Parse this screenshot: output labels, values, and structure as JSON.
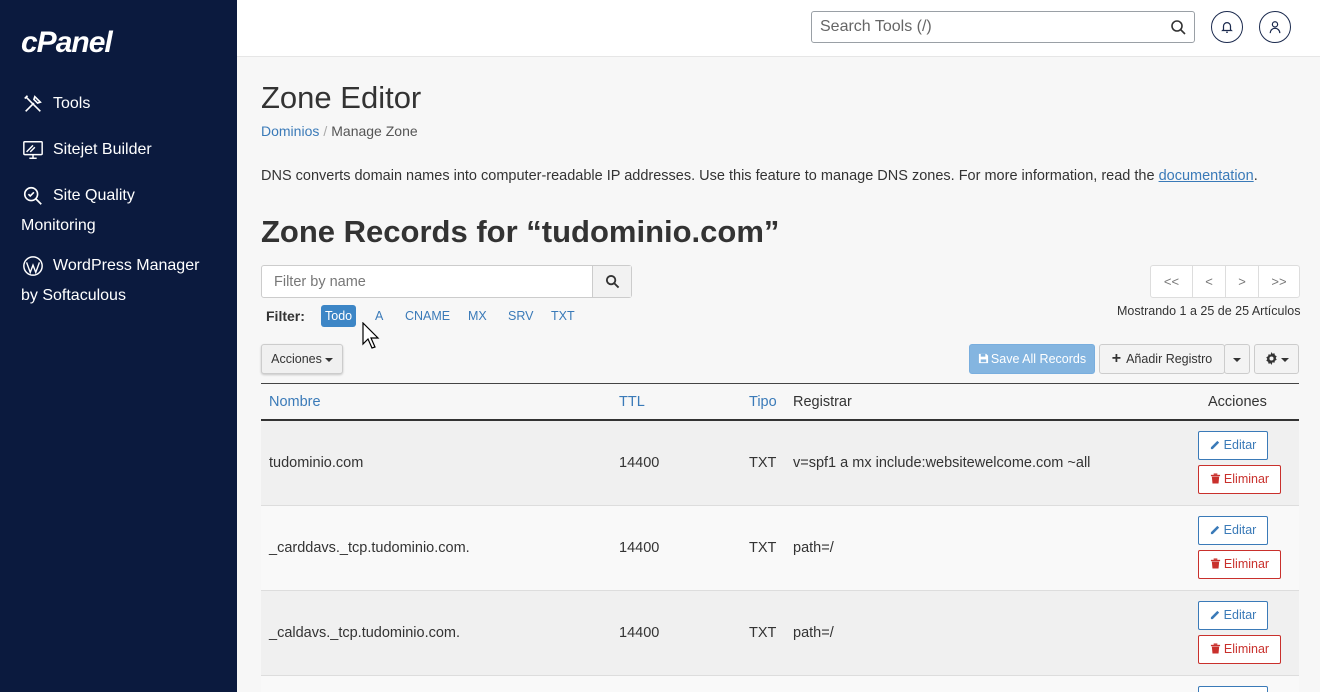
{
  "sidebar": {
    "logo": "cPanel",
    "items": [
      {
        "label": "Tools",
        "icon": "tools-icon"
      },
      {
        "label": "Sitejet Builder",
        "icon": "sitejet-icon"
      },
      {
        "label": "Site Quality",
        "label2": "Monitoring",
        "icon": "site-quality-icon"
      },
      {
        "label": "WordPress Manager",
        "label2": "by Softaculous",
        "icon": "wordpress-icon"
      }
    ]
  },
  "topbar": {
    "search_placeholder": "Search Tools (/)"
  },
  "page": {
    "title": "Zone Editor",
    "breadcrumb": {
      "link": "Dominios",
      "separator": "/",
      "current": "Manage Zone"
    },
    "description": "DNS converts domain names into computer-readable IP addresses. Use this feature to manage DNS zones. For more information, read the ",
    "description_link": "documentation",
    "description_end": ".",
    "zone_title": "Zone Records for “tudominio.com”"
  },
  "filter": {
    "placeholder": "Filter by name",
    "label": "Filter:",
    "chips": [
      "Todo",
      "A",
      "CNAME",
      "MX",
      "SRV",
      "TXT"
    ],
    "active": "Todo"
  },
  "pager": {
    "first": "<<",
    "prev": "<",
    "next": ">",
    "last": ">>",
    "showing": "Mostrando 1 a 25 de 25 Artículos"
  },
  "toolbar": {
    "acciones": "Acciones",
    "save_all": "Save All Records",
    "add_record": "Añadir Registro"
  },
  "table": {
    "headers": {
      "nombre": "Nombre",
      "ttl": "TTL",
      "tipo": "Tipo",
      "registrar": "Registrar",
      "acciones": "Acciones"
    },
    "edit_label": "Editar",
    "delete_label": "Eliminar",
    "rows": [
      {
        "nombre": "tudominio.com",
        "ttl": "14400",
        "tipo": "TXT",
        "registrar": "v=spf1 a mx include:websitewelcome.com ~all"
      },
      {
        "nombre": "_carddavs._tcp.tudominio.com.",
        "ttl": "14400",
        "tipo": "TXT",
        "registrar": "path=/"
      },
      {
        "nombre": "_caldavs._tcp.tudominio.com.",
        "ttl": "14400",
        "tipo": "TXT",
        "registrar": "path=/"
      }
    ]
  },
  "colors": {
    "sidebar_bg": "#0b1a3e",
    "link": "#3a7ab8",
    "danger": "#c9302c",
    "primary_disabled": "#84b5e0"
  }
}
